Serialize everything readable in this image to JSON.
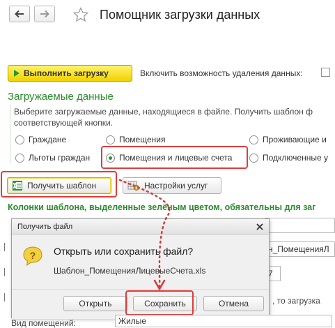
{
  "window": {
    "title": "Помощник загрузки данных"
  },
  "toolbar": {
    "run_label": "Выполнить загрузку",
    "delete_option_label": "Включить возможность удаления данных:",
    "delete_option_checked": false
  },
  "section": {
    "title": "Загружаемые данные",
    "description": "Выберите загружаемые данные, находящиеся в файле. Получить шаблон ф соответствующей кнопки."
  },
  "radios": [
    {
      "label": "Граждане",
      "selected": false
    },
    {
      "label": "Помещения",
      "selected": false
    },
    {
      "label": "Проживающие и",
      "selected": false
    },
    {
      "label": "Льготы граждан",
      "selected": false
    },
    {
      "label": "Помещения и лицевые счета",
      "selected": true
    },
    {
      "label": "Подключенные у",
      "selected": false
    }
  ],
  "buttons": {
    "get_template": "Получить шаблон",
    "service_settings": "Настройки услуг"
  },
  "green_note": "Колонки шаблона, выделенные зелёным цветом, обязательны для заг",
  "background_fields": {
    "field_value_1": "н_ПомещенияЛ",
    "field_value_2": "7",
    "note_right": ", то загрузка"
  },
  "dialog": {
    "title": "Получить файл",
    "heading": "Открыть или сохранить файл?",
    "filename": "Шаблон_ПомещенияЛицевыеСчета.xls",
    "open": "Открыть",
    "save": "Сохранить",
    "cancel": "Отмена"
  },
  "bottom": {
    "label": "Вид помещений:",
    "value": "Жилые"
  },
  "colors": {
    "accent_green": "#2a8a2a",
    "highlight_red": "#e23b3b",
    "run_button_yellow": "#f2d200"
  }
}
